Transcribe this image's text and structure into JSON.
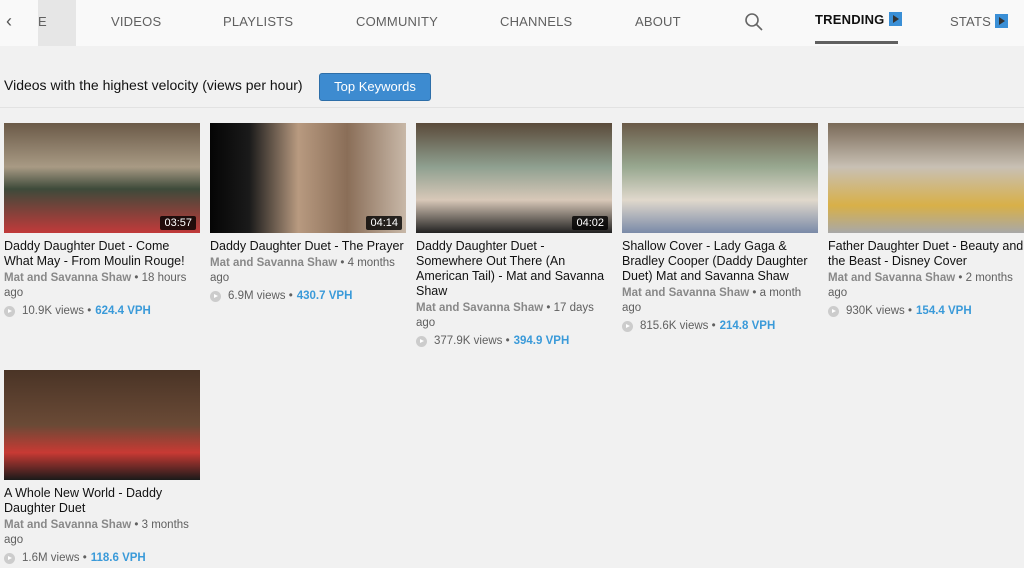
{
  "nav": {
    "partial_tab": "E",
    "tabs": [
      "VIDEOS",
      "PLAYLISTS",
      "COMMUNITY",
      "CHANNELS",
      "ABOUT"
    ],
    "trending": "TRENDING",
    "stats": "STATS"
  },
  "heading": "Videos with the highest velocity (views per hour)",
  "top_keywords_label": "Top Keywords",
  "videos": [
    {
      "title": "Daddy Daughter Duet - Come What May - From Moulin Rouge!",
      "channel": "Mat and Savanna Shaw",
      "age": "• 18 hours ago",
      "views": "10.9K views •",
      "vph": "624.4 VPH",
      "duration": "03:57",
      "bg": "linear-gradient(180deg,#6b5a48 0%,#a89a84 40%,#3e4a3a 60%,#c23a3a 100%)"
    },
    {
      "title": "Daddy Daughter Duet - The Prayer",
      "channel": "Mat and Savanna Shaw",
      "age": "• 4 months ago",
      "views": "6.9M views •",
      "vph": "430.7 VPH",
      "duration": "04:14",
      "bg": "linear-gradient(90deg,#050505 0%,#1a1a1a 20%,#b89a80 45%,#8a6e58 70%,#c8b8a8 100%)"
    },
    {
      "title": "Daddy Daughter Duet - Somewhere Out There (An American Tail) - Mat and Savanna Shaw",
      "channel": "Mat and Savanna Shaw",
      "age": "• 17 days ago",
      "views": "377.9K views •",
      "vph": "394.9 VPH",
      "duration": "04:02",
      "bg": "linear-gradient(180deg,#5a4a3a 0%,#8fa090 40%,#d8c8b8 70%,#222 100%)"
    },
    {
      "title": "Shallow Cover - Lady Gaga & Bradley Cooper (Daddy Daughter Duet) Mat and Savanna Shaw",
      "channel": "Mat and Savanna Shaw",
      "age": "• a month ago",
      "views": "815.6K views •",
      "vph": "214.8 VPH",
      "duration": "",
      "bg": "linear-gradient(180deg,#6a5a48 0%,#98a890 40%,#e0d8cc 70%,#7a8aa8 100%)"
    },
    {
      "title": "Father Daughter Duet - Beauty and the Beast - Disney Cover",
      "channel": "Mat and Savanna Shaw",
      "age": "• 2 months ago",
      "views": "930K views •",
      "vph": "154.4 VPH",
      "duration": "",
      "bg": "linear-gradient(180deg,#7a6a58 0%,#c8c0b4 40%,#d8b048 75%,#a8a8a8 100%)"
    },
    {
      "title": "A Whole New World - Daddy Daughter Duet",
      "channel": "Mat and Savanna Shaw",
      "age": "• 3 months ago",
      "views": "1.6M views •",
      "vph": "118.6 VPH",
      "duration": "",
      "bg": "linear-gradient(180deg,#4a3426 0%,#6a4a36 50%,#c83a34 75%,#1a1a1a 100%)"
    }
  ]
}
